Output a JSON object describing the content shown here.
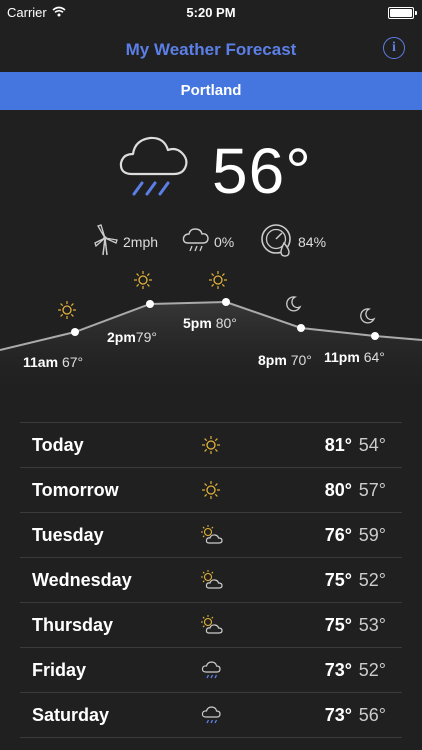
{
  "status_bar": {
    "carrier": "Carrier",
    "time": "5:20 PM"
  },
  "nav": {
    "title": "My Weather Forecast",
    "info_label": "i"
  },
  "city": "Portland",
  "current": {
    "icon": "rain-cloud-icon",
    "temperature": "56°",
    "wind": "2mph",
    "precip": "0%",
    "humidity": "84%"
  },
  "hourly": [
    {
      "time": "11am",
      "temp": "67°",
      "icon": "sun-icon"
    },
    {
      "time": "2pm",
      "temp": "79°",
      "icon": "sun-icon"
    },
    {
      "time": "5pm",
      "temp": "80°",
      "icon": "sun-icon"
    },
    {
      "time": "8pm",
      "temp": "70°",
      "icon": "moon-icon"
    },
    {
      "time": "11pm",
      "temp": "64°",
      "icon": "moon-icon"
    }
  ],
  "daily": [
    {
      "day": "Today",
      "icon": "sun-icon",
      "hi": "81°",
      "lo": "54°"
    },
    {
      "day": "Tomorrow",
      "icon": "sun-icon",
      "hi": "80°",
      "lo": "57°"
    },
    {
      "day": "Tuesday",
      "icon": "partly-cloudy-icon",
      "hi": "76°",
      "lo": "59°"
    },
    {
      "day": "Wednesday",
      "icon": "partly-cloudy-icon",
      "hi": "75°",
      "lo": "52°"
    },
    {
      "day": "Thursday",
      "icon": "partly-cloudy-icon",
      "hi": "75°",
      "lo": "53°"
    },
    {
      "day": "Friday",
      "icon": "rain-icon",
      "hi": "73°",
      "lo": "52°"
    },
    {
      "day": "Saturday",
      "icon": "rain-icon",
      "hi": "73°",
      "lo": "56°"
    }
  ],
  "colors": {
    "accent": "#5b7fe6",
    "city_bar": "#4576e0",
    "sun": "#e2b23a",
    "rain": "#5b7fe6"
  }
}
